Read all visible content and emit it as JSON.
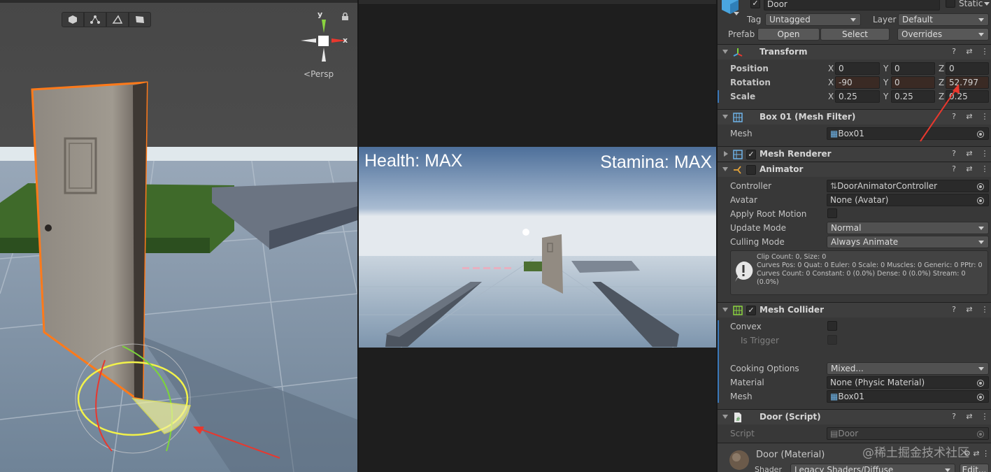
{
  "colors": {
    "accent_blue": "#3a79bb",
    "selection_orange": "#ff7a1a",
    "arrow_red": "#e8382e",
    "gizmo_yellow": "#f2f24a",
    "gizmo_green": "#7cd43a"
  },
  "scene": {
    "persp_label": "Persp",
    "gizmo_y": "y",
    "gizmo_x": "x"
  },
  "game": {
    "health_text": "Health: MAX",
    "stamina_text": "Stamina: MAX"
  },
  "inspector": {
    "object_name": "Door",
    "static_label": "Static",
    "tag_label": "Tag",
    "tag_value": "Untagged",
    "layer_label": "Layer",
    "layer_value": "Default",
    "prefab_label": "Prefab",
    "prefab_open": "Open",
    "prefab_select": "Select",
    "prefab_overrides": "Overrides",
    "transform": {
      "title": "Transform",
      "position_label": "Position",
      "rotation_label": "Rotation",
      "scale_label": "Scale",
      "pos": {
        "x": "0",
        "y": "0",
        "z": "0"
      },
      "rot": {
        "x": "-90",
        "y": "0",
        "z": "52.797"
      },
      "scale": {
        "x": "0.25",
        "y": "0.25",
        "z": "0.25"
      }
    },
    "mesh_filter": {
      "title": "Box 01 (Mesh Filter)",
      "mesh_label": "Mesh",
      "mesh_value": "Box01"
    },
    "mesh_renderer": {
      "title": "Mesh Renderer"
    },
    "animator": {
      "title": "Animator",
      "controller_label": "Controller",
      "controller_value": "DoorAnimatorController",
      "avatar_label": "Avatar",
      "avatar_value": "None (Avatar)",
      "apply_root_label": "Apply Root Motion",
      "update_mode_label": "Update Mode",
      "update_mode_value": "Normal",
      "culling_mode_label": "Culling Mode",
      "culling_mode_value": "Always Animate",
      "info_line1": "Clip Count: 0, Size: 0",
      "info_line2": "Curves Pos: 0 Quat: 0 Euler: 0 Scale: 0 Muscles: 0 Generic: 0 PPtr: 0",
      "info_line3": "Curves Count: 0 Constant: 0 (0.0%) Dense: 0 (0.0%) Stream: 0",
      "info_line4": "(0.0%)"
    },
    "mesh_collider": {
      "title": "Mesh Collider",
      "convex_label": "Convex",
      "trigger_label": "Is Trigger",
      "cooking_label": "Cooking Options",
      "cooking_value": "Mixed...",
      "material_label": "Material",
      "material_value": "None (Physic Material)",
      "mesh_label": "Mesh",
      "mesh_value": "Box01"
    },
    "door_script": {
      "title": "Door (Script)",
      "script_label": "Script",
      "script_value": "Door"
    },
    "material": {
      "title": "Door (Material)",
      "shader_label": "Shader",
      "shader_value": "Legacy Shaders/Diffuse",
      "edit_label": "Edit..."
    }
  },
  "watermark": "@稀土掘金技术社区"
}
